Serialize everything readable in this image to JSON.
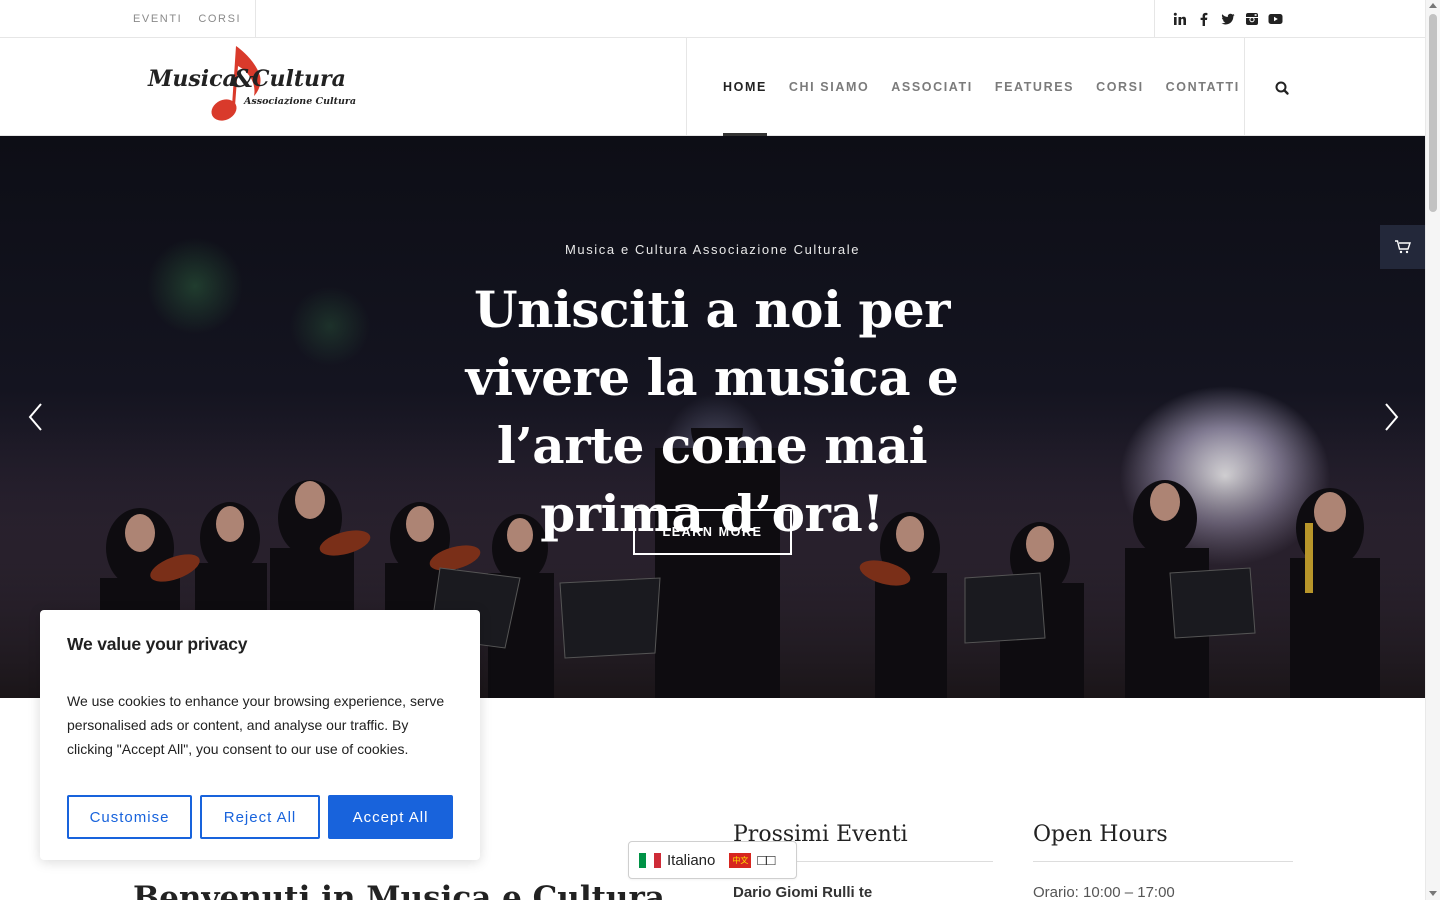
{
  "topbar": {
    "links": [
      "EVENTI",
      "CORSI"
    ],
    "social": [
      "linkedin-icon",
      "facebook-icon",
      "twitter-icon",
      "instagram-icon",
      "youtube-icon"
    ]
  },
  "header": {
    "logo": {
      "main": "Musica & Cultura",
      "sub": "Associazione Culturale"
    },
    "nav": [
      "HOME",
      "CHI SIAMO",
      "ASSOCIATI",
      "FEATURES",
      "CORSI",
      "CONTATTI"
    ],
    "active": "HOME"
  },
  "hero": {
    "kicker": "Musica e Cultura Associazione Culturale",
    "title": "Unisciti a noi per vivere la musica e l’arte come mai prima d’ora!",
    "button": "LEARN MORE"
  },
  "content": {
    "welcome": "Benvenuti in Musica e Cultura",
    "events_title": "Prossimi Eventi",
    "events_first": "Dario Giomi Rulli te",
    "hours_title": "Open Hours",
    "hours_first": "Orario: 10:00 – 17:00"
  },
  "lang": {
    "it": "Italiano",
    "cn_flag": "中文",
    "cn": "□□"
  },
  "cookie": {
    "title": "We value your privacy",
    "text": "We use cookies to enhance your browsing experience, serve personalised ads or content, and analyse our traffic. By clicking \"Accept All\", you consent to our use of cookies.",
    "customise": "Customise",
    "reject": "Reject All",
    "accept": "Accept All"
  },
  "colors": {
    "accent_blue": "#1863dc",
    "logo_red": "#d93a2b",
    "nav_active": "#222222",
    "nav_inactive": "#7b7b7b"
  }
}
